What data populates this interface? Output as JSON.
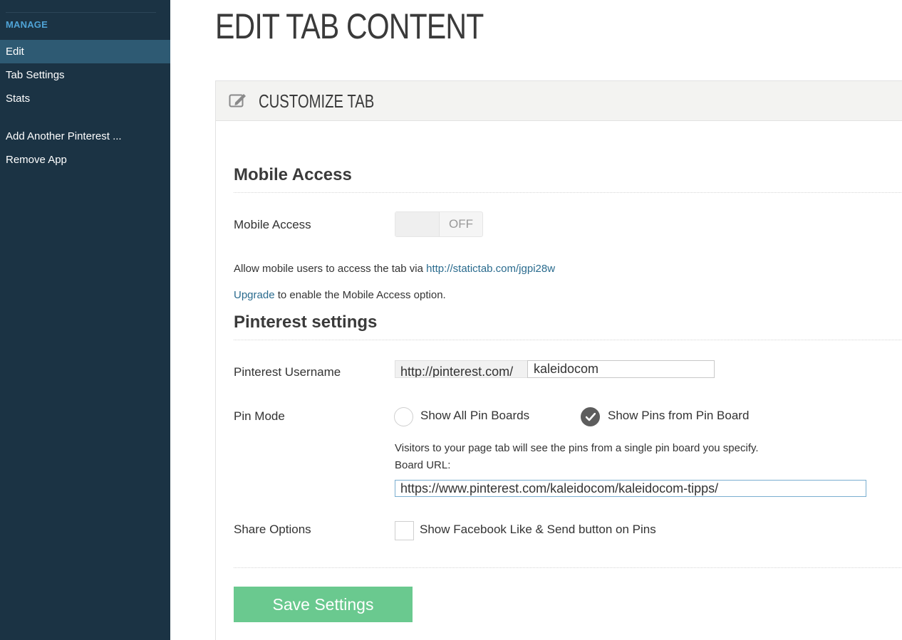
{
  "sidebar": {
    "section_title": "MANAGE",
    "items": [
      {
        "label": "Edit",
        "active": true
      },
      {
        "label": "Tab Settings"
      },
      {
        "label": "Stats"
      },
      {
        "label": "Add Another Pinterest ..."
      },
      {
        "label": "Remove App"
      }
    ]
  },
  "page": {
    "title": "EDIT TAB CONTENT",
    "panel_title": "CUSTOMIZE TAB"
  },
  "mobile": {
    "heading": "Mobile Access",
    "label": "Mobile Access",
    "toggle_state": "OFF",
    "info_prefix": "Allow mobile users to access the tab via ",
    "info_link": "http://statictab.com/jgpi28w",
    "upgrade_link": "Upgrade",
    "upgrade_suffix": " to enable the Mobile Access option."
  },
  "pinterest": {
    "heading": "Pinterest settings",
    "username_label": "Pinterest Username",
    "username_prefix": "http://pinterest.com/",
    "username_value": "kaleidocom",
    "pin_mode_label": "Pin Mode",
    "option_all": "Show All Pin Boards",
    "option_board": "Show Pins from Pin Board",
    "selected_option": "Show Pins from Pin Board",
    "board_info": "Visitors to your page tab will see the pins from a single pin board you specify.",
    "board_url_label": "Board URL:",
    "board_url_value": "https://www.pinterest.com/kaleidocom/kaleidocom-tipps/",
    "share_label": "Share Options",
    "share_option": "Show Facebook Like & Send button on Pins",
    "share_checked": false
  },
  "actions": {
    "save_label": "Save Settings"
  },
  "colors": {
    "sidebar_bg": "#1b3344",
    "sidebar_active": "#2e5a73",
    "section_title": "#4fa3d6",
    "link": "#2a6b8e",
    "save_button": "#6ac98f"
  }
}
